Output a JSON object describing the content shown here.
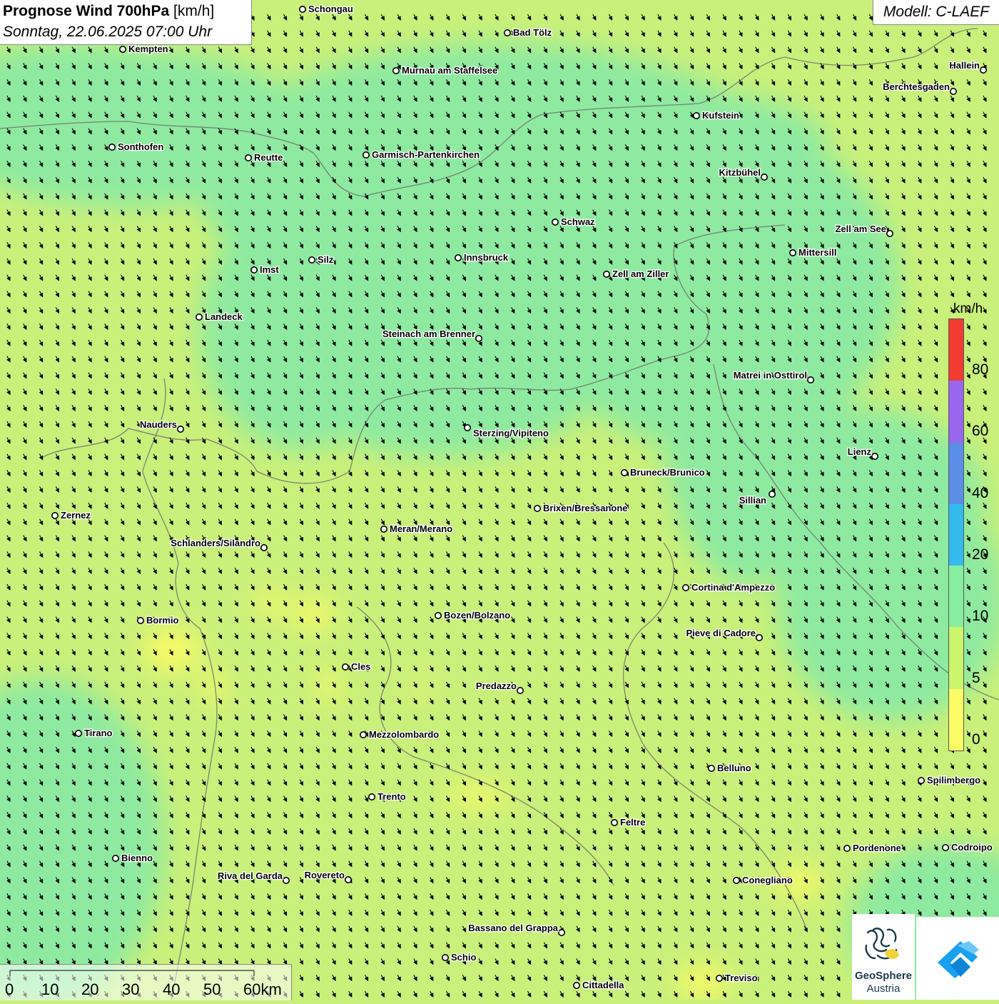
{
  "header": {
    "title": "Prognose Wind 700hPa",
    "title_unit": "[km/h]",
    "subtitle": "Sonntag, 22.06.2025 07:00 Uhr",
    "model": "Modell: C-LAEF"
  },
  "legend": {
    "unit": "km/h",
    "ticks": [
      "80",
      "60",
      "40",
      "20",
      "10",
      "5",
      "0"
    ],
    "colors": [
      "#f23c32",
      "#9966ee",
      "#5b8ee6",
      "#33bbee",
      "#88ee9f",
      "#cbf56a",
      "#fbfb66"
    ]
  },
  "scale_bar": {
    "labels": [
      "0",
      "10",
      "20",
      "30",
      "40",
      "50",
      "60km"
    ]
  },
  "branding": {
    "org_line1": "GeoSphere",
    "org_line2": "Austria",
    "logo_icon": "geosphere-logo-icon",
    "app_icon": "wetter-app-icon"
  },
  "map": {
    "wind_direction": "north-northwest",
    "arrow_color": "#000000",
    "field_colors": {
      "calm": "#fbfb66",
      "light": "#c9f07a",
      "moderate": "#8eeaa0"
    },
    "cities": [
      {
        "name": "Schongau"
      },
      {
        "name": "Bad Tölz"
      },
      {
        "name": "Kempten"
      },
      {
        "name": "Murnau am Staffelsee"
      },
      {
        "name": "Hallein"
      },
      {
        "name": "Berchtesgaden"
      },
      {
        "name": "Kufstein"
      },
      {
        "name": "Sonthofen"
      },
      {
        "name": "Reutte"
      },
      {
        "name": "Garmisch-Partenkirchen"
      },
      {
        "name": "Kitzbühel"
      },
      {
        "name": "Schwaz"
      },
      {
        "name": "Zell am See"
      },
      {
        "name": "Mittersill"
      },
      {
        "name": "Innsbruck"
      },
      {
        "name": "Silz"
      },
      {
        "name": "Imst"
      },
      {
        "name": "Zell am Ziller"
      },
      {
        "name": "Landeck"
      },
      {
        "name": "Steinach am Brenner"
      },
      {
        "name": "Matrei in Osttirol"
      },
      {
        "name": "Nauders"
      },
      {
        "name": "Sterzing/Vipiteno"
      },
      {
        "name": "Lienz"
      },
      {
        "name": "Bruneck/Brunico"
      },
      {
        "name": "Sillian"
      },
      {
        "name": "Brixen/Bressanone"
      },
      {
        "name": "Zernez"
      },
      {
        "name": "Meran/Merano"
      },
      {
        "name": "Schlanders/Silandro"
      },
      {
        "name": "Cortina d'Ampezzo"
      },
      {
        "name": "Bozen/Bolzano"
      },
      {
        "name": "Bormio"
      },
      {
        "name": "Pieve di Cadore"
      },
      {
        "name": "Cles"
      },
      {
        "name": "Predazzo"
      },
      {
        "name": "Tirano"
      },
      {
        "name": "Mezzolombardo"
      },
      {
        "name": "Belluno"
      },
      {
        "name": "Spilimbergo"
      },
      {
        "name": "Trento"
      },
      {
        "name": "Feltre"
      },
      {
        "name": "Pordenone"
      },
      {
        "name": "Codroipo"
      },
      {
        "name": "Bienno"
      },
      {
        "name": "Riva del Garda"
      },
      {
        "name": "Rovereto"
      },
      {
        "name": "Conegliano"
      },
      {
        "name": "Bassano del Grappa"
      },
      {
        "name": "Schio"
      },
      {
        "name": "Treviso"
      },
      {
        "name": "Cittadella"
      }
    ]
  }
}
